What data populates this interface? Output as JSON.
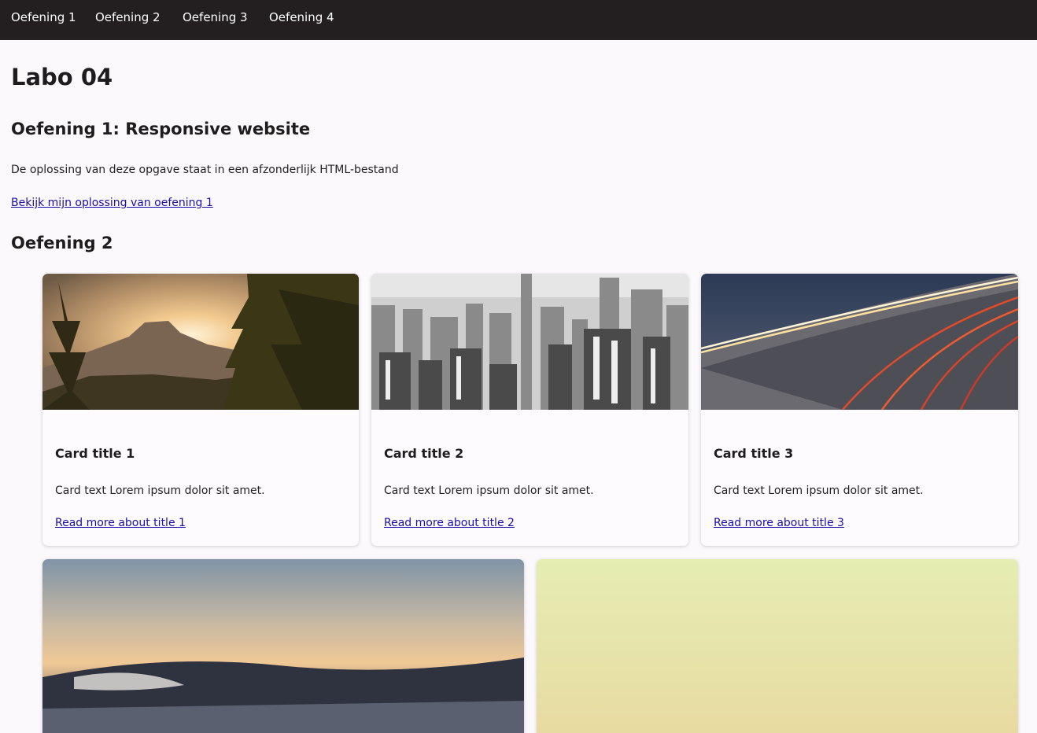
{
  "nav": {
    "items": [
      "Oefening 1",
      "Oefening 2",
      "Oefening 3",
      "Oefening 4"
    ]
  },
  "page": {
    "title": "Labo 04",
    "ex1_heading": "Oefening 1: Responsive website",
    "ex1_text": "De oplossing van deze opgave staat in een afzonderlijk HTML-bestand",
    "ex1_link": "Bekijk mijn oplossing van oefening 1",
    "ex2_heading": "Oefening 2"
  },
  "cards": [
    {
      "title": "Card title 1",
      "text": "Card text Lorem ipsum dolor sit amet.",
      "link": "Read more about title 1",
      "image": "mountain-sunset-photo"
    },
    {
      "title": "Card title 2",
      "text": "Card text Lorem ipsum dolor sit amet.",
      "link": "Read more about title 2",
      "image": "city-skyline-photo"
    },
    {
      "title": "Card title 3",
      "text": "Card text Lorem ipsum dolor sit amet.",
      "link": "Read more about title 3",
      "image": "highway-light-trails-photo"
    },
    {
      "image": "ocean-wave-sunset-photo"
    },
    {
      "image": "pale-green-landscape-photo"
    }
  ],
  "colors": {
    "nav_bg": "#231f20",
    "page_bg": "#fcf9fc",
    "link": "#1a0dab"
  }
}
